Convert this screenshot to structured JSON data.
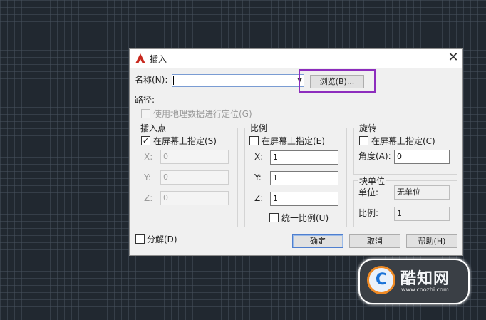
{
  "dialog": {
    "title": "插入",
    "close_glyph": "✕",
    "name_label": "名称(N):",
    "name_value": "",
    "browse_label": "浏览(B)...",
    "path_label": "路径:",
    "geo_label": "使用地理数据进行定位(G)"
  },
  "insertion_point": {
    "title": "插入点",
    "on_screen_label": "在屏幕上指定(S)",
    "on_screen_checked": "✓",
    "x_label": "X:",
    "x_value": "0",
    "y_label": "Y:",
    "y_value": "0",
    "z_label": "Z:",
    "z_value": "0"
  },
  "scale": {
    "title": "比例",
    "on_screen_label": "在屏幕上指定(E)",
    "x_label": "X:",
    "x_value": "1",
    "y_label": "Y:",
    "y_value": "1",
    "z_label": "Z:",
    "z_value": "1",
    "uniform_label": "统一比例(U)"
  },
  "rotation": {
    "title": "旋转",
    "on_screen_label": "在屏幕上指定(C)",
    "angle_label": "角度(A):",
    "angle_value": "0"
  },
  "block_unit": {
    "title": "块单位",
    "unit_label": "单位:",
    "unit_value": "无单位",
    "factor_label": "比例:",
    "factor_value": "1"
  },
  "footer": {
    "explode_label": "分解(D)",
    "ok_label": "确定",
    "cancel_label": "取消",
    "help_label": "帮助(H)"
  },
  "watermark": {
    "mark": "C",
    "title": "酷知网",
    "url": "www.coozhi.com"
  },
  "colors": {
    "highlight": "#8d2dbd",
    "app_icon": "#c8281e"
  }
}
